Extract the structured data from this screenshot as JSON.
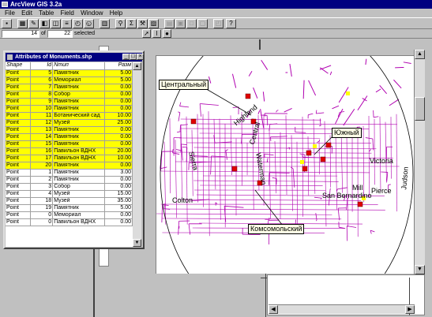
{
  "app": {
    "title": "ArcView GIS 3.2a"
  },
  "menu": {
    "items": [
      "File",
      "Edit",
      "Table",
      "Field",
      "Window",
      "Help"
    ]
  },
  "toolbar2": {
    "count_selected": "14",
    "of_label": "of",
    "count_total": "22",
    "selected_label": "selected"
  },
  "attributes": {
    "title": "Attributes of Monuments.shp",
    "columns": [
      "Shape",
      "Id",
      "Nтип",
      "Pазм"
    ],
    "rows": [
      {
        "shape": "Point",
        "id": "5",
        "type": "Памятник",
        "size": "5.00",
        "selected": true
      },
      {
        "shape": "Point",
        "id": "6",
        "type": "Мемориал",
        "size": "5.00",
        "selected": true
      },
      {
        "shape": "Point",
        "id": "7",
        "type": "Памятник",
        "size": "0.00",
        "selected": true
      },
      {
        "shape": "Point",
        "id": "8",
        "type": "Собор",
        "size": "0.00",
        "selected": true
      },
      {
        "shape": "Point",
        "id": "9",
        "type": "Памятник",
        "size": "0.00",
        "selected": true
      },
      {
        "shape": "Point",
        "id": "10",
        "type": "Памятник",
        "size": "0.00",
        "selected": true
      },
      {
        "shape": "Point",
        "id": "11",
        "type": "Ботанический сад",
        "size": "10.00",
        "selected": true
      },
      {
        "shape": "Point",
        "id": "12",
        "type": "Музей",
        "size": "25.00",
        "selected": true
      },
      {
        "shape": "Point",
        "id": "13",
        "type": "Памятник",
        "size": "0.00",
        "selected": true
      },
      {
        "shape": "Point",
        "id": "14",
        "type": "Памятник",
        "size": "0.00",
        "selected": true
      },
      {
        "shape": "Point",
        "id": "15",
        "type": "Памятник",
        "size": "0.00",
        "selected": true
      },
      {
        "shape": "Point",
        "id": "16",
        "type": "Павильон ВДНХ",
        "size": "20.00",
        "selected": true
      },
      {
        "shape": "Point",
        "id": "17",
        "type": "Павильон ВДНХ",
        "size": "10.00",
        "selected": true
      },
      {
        "shape": "Point",
        "id": "20",
        "type": "Памятник",
        "size": "0.00",
        "selected": true
      },
      {
        "shape": "Point",
        "id": "1",
        "type": "Памятник",
        "size": "3.00",
        "selected": false
      },
      {
        "shape": "Point",
        "id": "2",
        "type": "Памятник",
        "size": "0.00",
        "selected": false
      },
      {
        "shape": "Point",
        "id": "3",
        "type": "Собор",
        "size": "0.00",
        "selected": false
      },
      {
        "shape": "Point",
        "id": "4",
        "type": "Музей",
        "size": "15.00",
        "selected": false
      },
      {
        "shape": "Point",
        "id": "18",
        "type": "Музей",
        "size": "35.00",
        "selected": false
      },
      {
        "shape": "Point",
        "id": "19",
        "type": "Памятник",
        "size": "5.00",
        "selected": false
      },
      {
        "shape": "Point",
        "id": "0",
        "type": "Мемориал",
        "size": "0.00",
        "selected": false
      },
      {
        "shape": "Point",
        "id": "0",
        "type": "Павильон ВДНХ",
        "size": "0.00",
        "selected": false
      }
    ]
  },
  "map": {
    "callouts": [
      "Центральный",
      "Южный",
      "Комсомольский"
    ],
    "labels": [
      "San Bernardino",
      "Mill",
      "Pierce",
      "Judson",
      "Sierra",
      "Waterman",
      "Highland",
      "Central",
      "Colton",
      "Victoria"
    ],
    "colors": {
      "roads": "#b000b0",
      "selection_circle": "#000000",
      "monuments": "#e00000",
      "highlight": "#ffff00"
    }
  }
}
